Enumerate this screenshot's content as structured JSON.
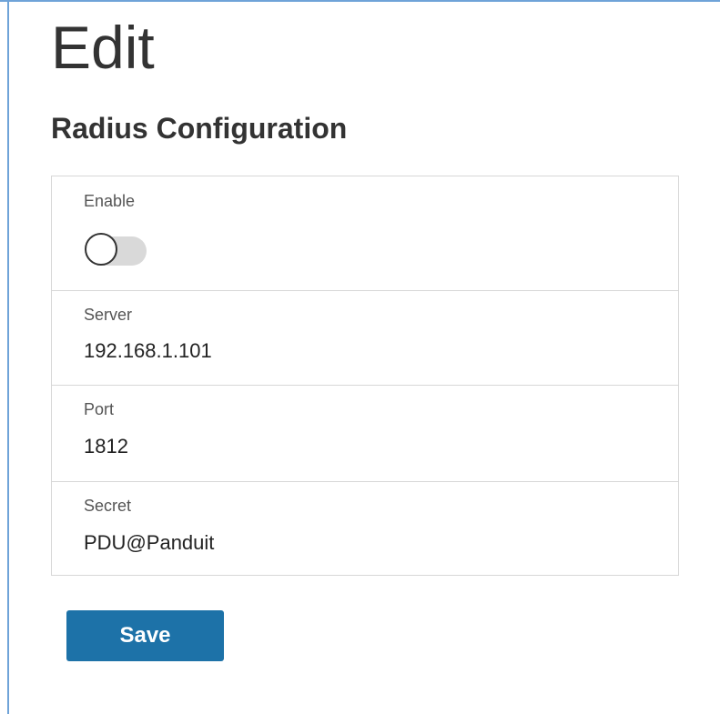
{
  "page": {
    "title": "Edit",
    "section_title": "Radius Configuration"
  },
  "form": {
    "enable": {
      "label": "Enable",
      "value": false
    },
    "server": {
      "label": "Server",
      "value": "192.168.1.101"
    },
    "port": {
      "label": "Port",
      "value": "1812"
    },
    "secret": {
      "label": "Secret",
      "value": "PDU@Panduit"
    }
  },
  "actions": {
    "save_label": "Save"
  },
  "colors": {
    "accent": "#1d72a8",
    "frame": "#6fa3d8",
    "border": "#d7d7d7",
    "toggle_track_off": "#d9d9d9"
  }
}
